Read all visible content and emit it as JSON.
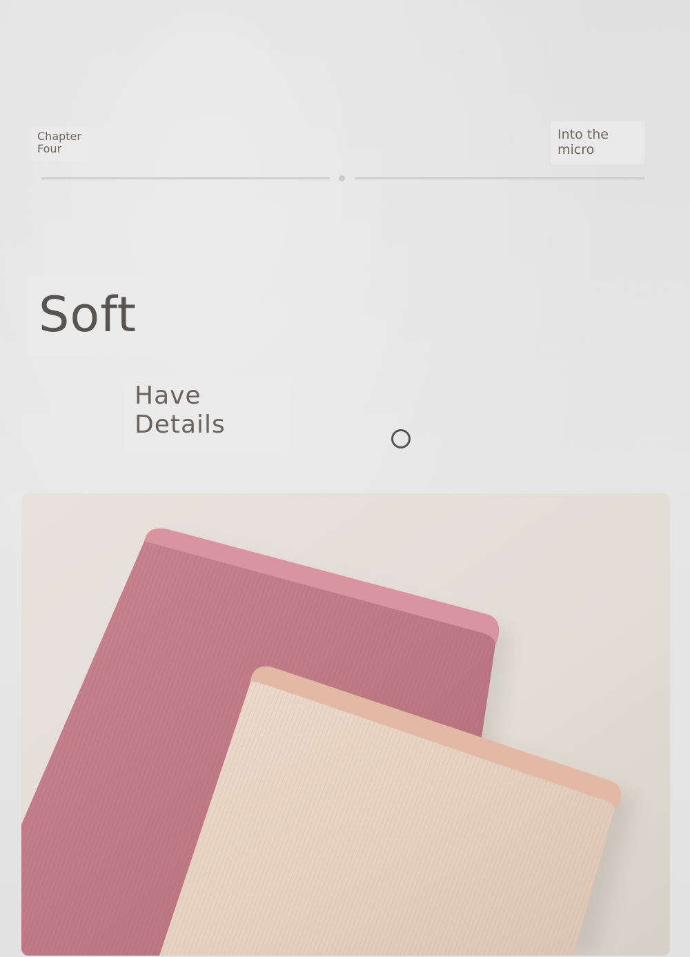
{
  "header": {
    "chapter_label": "Chapter\nFour",
    "section_label": "Into the\nmicro"
  },
  "hero": {
    "title": "Soft",
    "subtitle": "Have\nDetails"
  },
  "photo": {
    "subject": "two-socks-cuff-closeup",
    "colors": {
      "background": "#e4dfd7",
      "pink_sock": "#c98892",
      "beige_sock": "#e6cfbf"
    }
  },
  "icons": {
    "ring": "ring-icon",
    "divider_dot": "dot-icon"
  }
}
